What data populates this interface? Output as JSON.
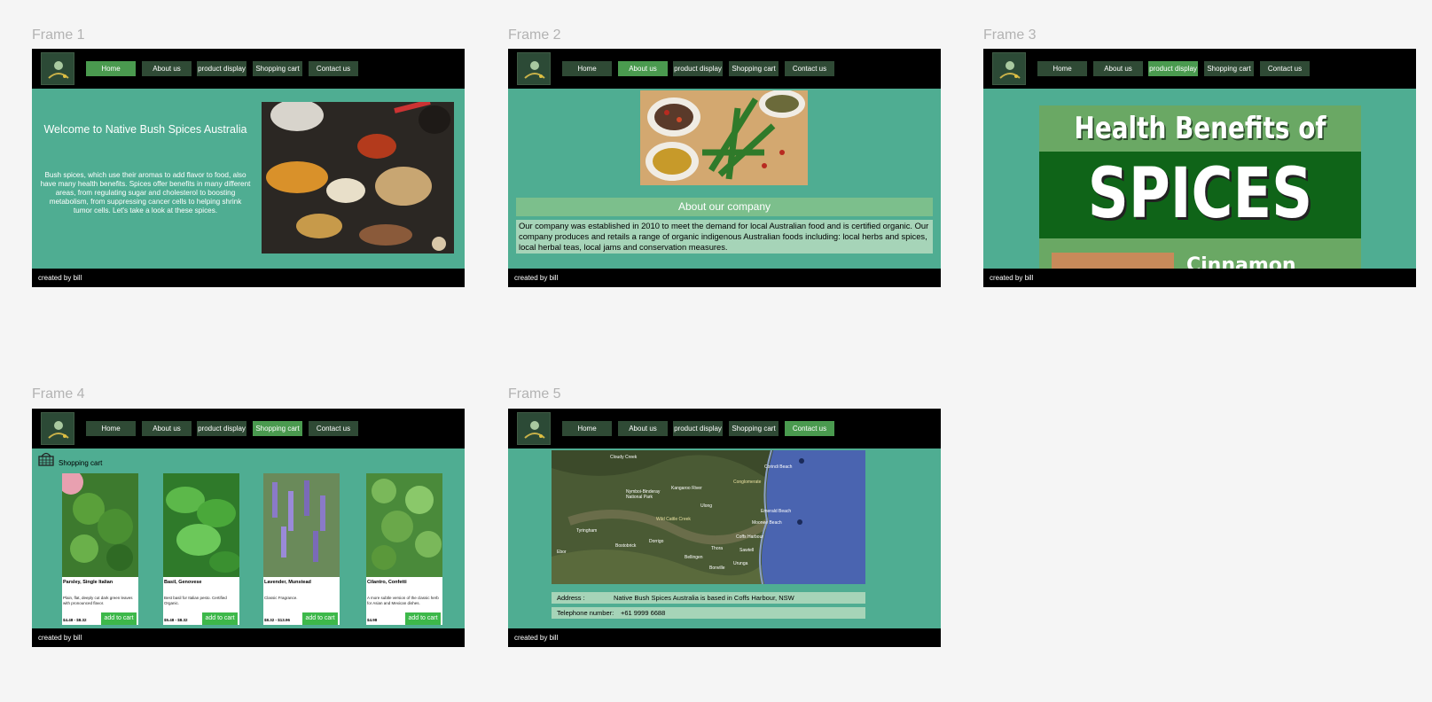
{
  "frame_labels": [
    "Frame 1",
    "Frame 2",
    "Frame 3",
    "Frame 4",
    "Frame 5"
  ],
  "nav": {
    "home": "Home",
    "about": "About us",
    "product": "product display",
    "cart": "Shopping cart",
    "contact": "Contact us"
  },
  "footer": "created by bill",
  "frame1": {
    "welcome": "Welcome to Native Bush Spices Australia",
    "intro": "Bush spices, which use their aromas to add flavor to food, also have many health benefits. Spices offer benefits in many different areas, from regulating sugar and cholesterol to boosting metabolism, from suppressing cancer cells to helping shrink tumor cells. Let's take a look at these spices."
  },
  "frame2": {
    "about_title": "About our company",
    "about_text": "Our company was established in 2010 to meet the demand for local Australian food and is certified organic. Our company produces and retails a range of organic indigenous Australian foods including: local herbs and spices, local herbal teas, local jams and conservation measures."
  },
  "frame3": {
    "banner_line1": "Health Benefits of",
    "banner_line2": "SPICES",
    "banner_line3": "Cinnamon"
  },
  "frame4": {
    "cart_label": "Shopping cart",
    "add_label": "add to cart",
    "products": [
      {
        "name": "Parsley, Single Italian",
        "desc": "Plain, flat, deeply cut dark green leaves with pronounced flavor.",
        "price": "$4.48 - $8.32"
      },
      {
        "name": "Basil, Genovese",
        "desc": "Best basil for Italian pesto. Certified Organic.",
        "price": "$5.48 - $8.32"
      },
      {
        "name": "Lavender, Munstead",
        "desc": "Classic Fragrance.",
        "price": "$8.32 - $13.96"
      },
      {
        "name": "Cilantro, Confetti",
        "desc": "A more subtle version of the classic herb for Asian and Mexican dishes.",
        "price": "$4.98"
      }
    ]
  },
  "frame5": {
    "address_label": "Address :",
    "address_value": "Native Bush Spices Australia is based in Coffs Harbour, NSW",
    "phone_label": "Telephone number:",
    "phone_value": "+61 9999 6688",
    "map_places": [
      "Cloudy Creek",
      "Nymboi-Binderay National Park",
      "Kangaroo River",
      "Conglomerate",
      "Ulong",
      "Wild Cattle Creek",
      "Coffs Harbour",
      "Sawtell",
      "Urunga",
      "Bellingen",
      "Dorrigo",
      "Bostobrick",
      "Ebor",
      "Tyringham",
      "Moonee Beach",
      "Emerald Beach",
      "Corindi Beach",
      "Bonville",
      "Thora"
    ]
  },
  "colors": {
    "frame_bg": "#4fad92",
    "nav_bg": "#000000",
    "nav_btn": "#2f4a35",
    "nav_active": "#4a9a4f",
    "add_btn": "#3db84a",
    "canvas": "#f5f5f5"
  }
}
